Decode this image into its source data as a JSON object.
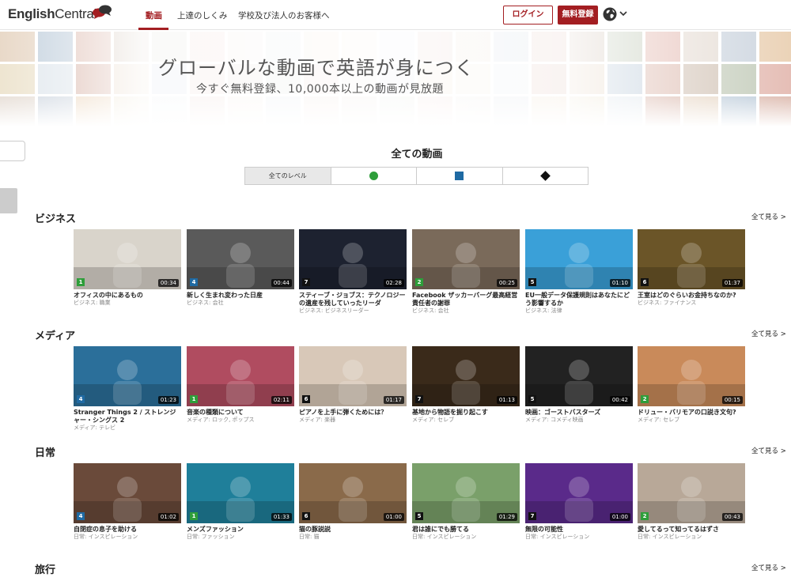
{
  "nav": {
    "logo_bold": "English",
    "logo_light": "Central",
    "links": [
      "動画",
      "上達のしくみ",
      "学校及び法人のお客様へ"
    ],
    "login": "ログイン",
    "signup": "無料登録"
  },
  "hero": {
    "title": "グローバルな動画で英語が身につく",
    "subtitle": "今すぐ無料登録、10,000本以上の動画が見放題"
  },
  "filter": {
    "heading": "全ての動画",
    "all_levels": "全てのレベル",
    "level_icons": [
      "green-circle-icon",
      "blue-square-icon",
      "black-diamond-icon"
    ]
  },
  "colors": {
    "brand": "#a31e22",
    "beginner": "#2e9e3a",
    "intermediate": "#1f6aa3",
    "advanced": "#111111"
  },
  "see_all": "全て見る >",
  "sections": [
    {
      "title": "ビジネス",
      "videos": [
        {
          "title": "オフィスの中にあるもの",
          "category": "ビジネス: 職業",
          "level": "1",
          "duration": "00:34",
          "bg": "#d9d4cb"
        },
        {
          "title": "新しく生まれ変わった日産",
          "category": "ビジネス: 会社",
          "level": "4",
          "duration": "00:44",
          "bg": "#5a5a5a"
        },
        {
          "title": "スティーブ・ジョブス：テクノロジーの遺産を残していったリーダ",
          "category": "ビジネス: ビジネスリーダー",
          "level": "7",
          "duration": "02:28",
          "bg": "#1d2230"
        },
        {
          "title": "Facebook ザッカーバーグ最高経営責任者の謝罪",
          "category": "ビジネス: 会社",
          "level": "2",
          "duration": "00:25",
          "bg": "#7a6a5a"
        },
        {
          "title": "EU一般データ保護規則はあなたにどう影響するか",
          "category": "ビジネス: 法律",
          "level": "5",
          "duration": "01:10",
          "bg": "#3aa0d8"
        },
        {
          "title": "王室はどのぐらいお金持ちなのか?",
          "category": "ビジネス: ファイナンス",
          "level": "6",
          "duration": "01:37",
          "bg": "#6b5528"
        }
      ]
    },
    {
      "title": "メディア",
      "videos": [
        {
          "title": "Stranger Things 2 / ストレンジャー・シングス 2",
          "category": "メディア: テレビ",
          "level": "4",
          "duration": "01:23",
          "bg": "#2b6f9a"
        },
        {
          "title": "音楽の種類について",
          "category": "メディア: ロック, ポップス",
          "level": "1",
          "duration": "02:11",
          "bg": "#b04c60"
        },
        {
          "title": "ピアノを上手に弾くためには？",
          "category": "メディア: 楽器",
          "level": "6",
          "duration": "01:17",
          "bg": "#d8c8b8"
        },
        {
          "title": "基地から物語を掘り起こす",
          "category": "メディア: セレブ",
          "level": "7",
          "duration": "01:13",
          "bg": "#3a2a1a"
        },
        {
          "title": "映画：ゴーストバスターズ",
          "category": "メディア: コメディ映画",
          "level": "5",
          "duration": "00:42",
          "bg": "#222222"
        },
        {
          "title": "ドリュー・バリモアの口説き文句?",
          "category": "メディア: セレブ",
          "level": "2",
          "duration": "00:15",
          "bg": "#c98a5a"
        }
      ]
    },
    {
      "title": "日常",
      "videos": [
        {
          "title": "自閉症の息子を助ける",
          "category": "日常: インスピレーション",
          "level": "4",
          "duration": "01:02",
          "bg": "#6a4a3a"
        },
        {
          "title": "メンズファッション",
          "category": "日常: ファッション",
          "level": "1",
          "duration": "01:33",
          "bg": "#1f7f9a"
        },
        {
          "title": "猫の豚説説",
          "category": "日常: 猫",
          "level": "6",
          "duration": "01:00",
          "bg": "#8a6a4a"
        },
        {
          "title": "君は誰にでも勝てる",
          "category": "日常: インスピレーション",
          "level": "5",
          "duration": "01:29",
          "bg": "#7aa06a"
        },
        {
          "title": "無限の可能性",
          "category": "日常: インスピレーション",
          "level": "7",
          "duration": "01:00",
          "bg": "#5a2a8a"
        },
        {
          "title": "愛してるって知ってるはずさ",
          "category": "日常: インスピレーション",
          "level": "2",
          "duration": "00:43",
          "bg": "#b8a898"
        }
      ]
    },
    {
      "title": "旅行",
      "videos": []
    }
  ]
}
